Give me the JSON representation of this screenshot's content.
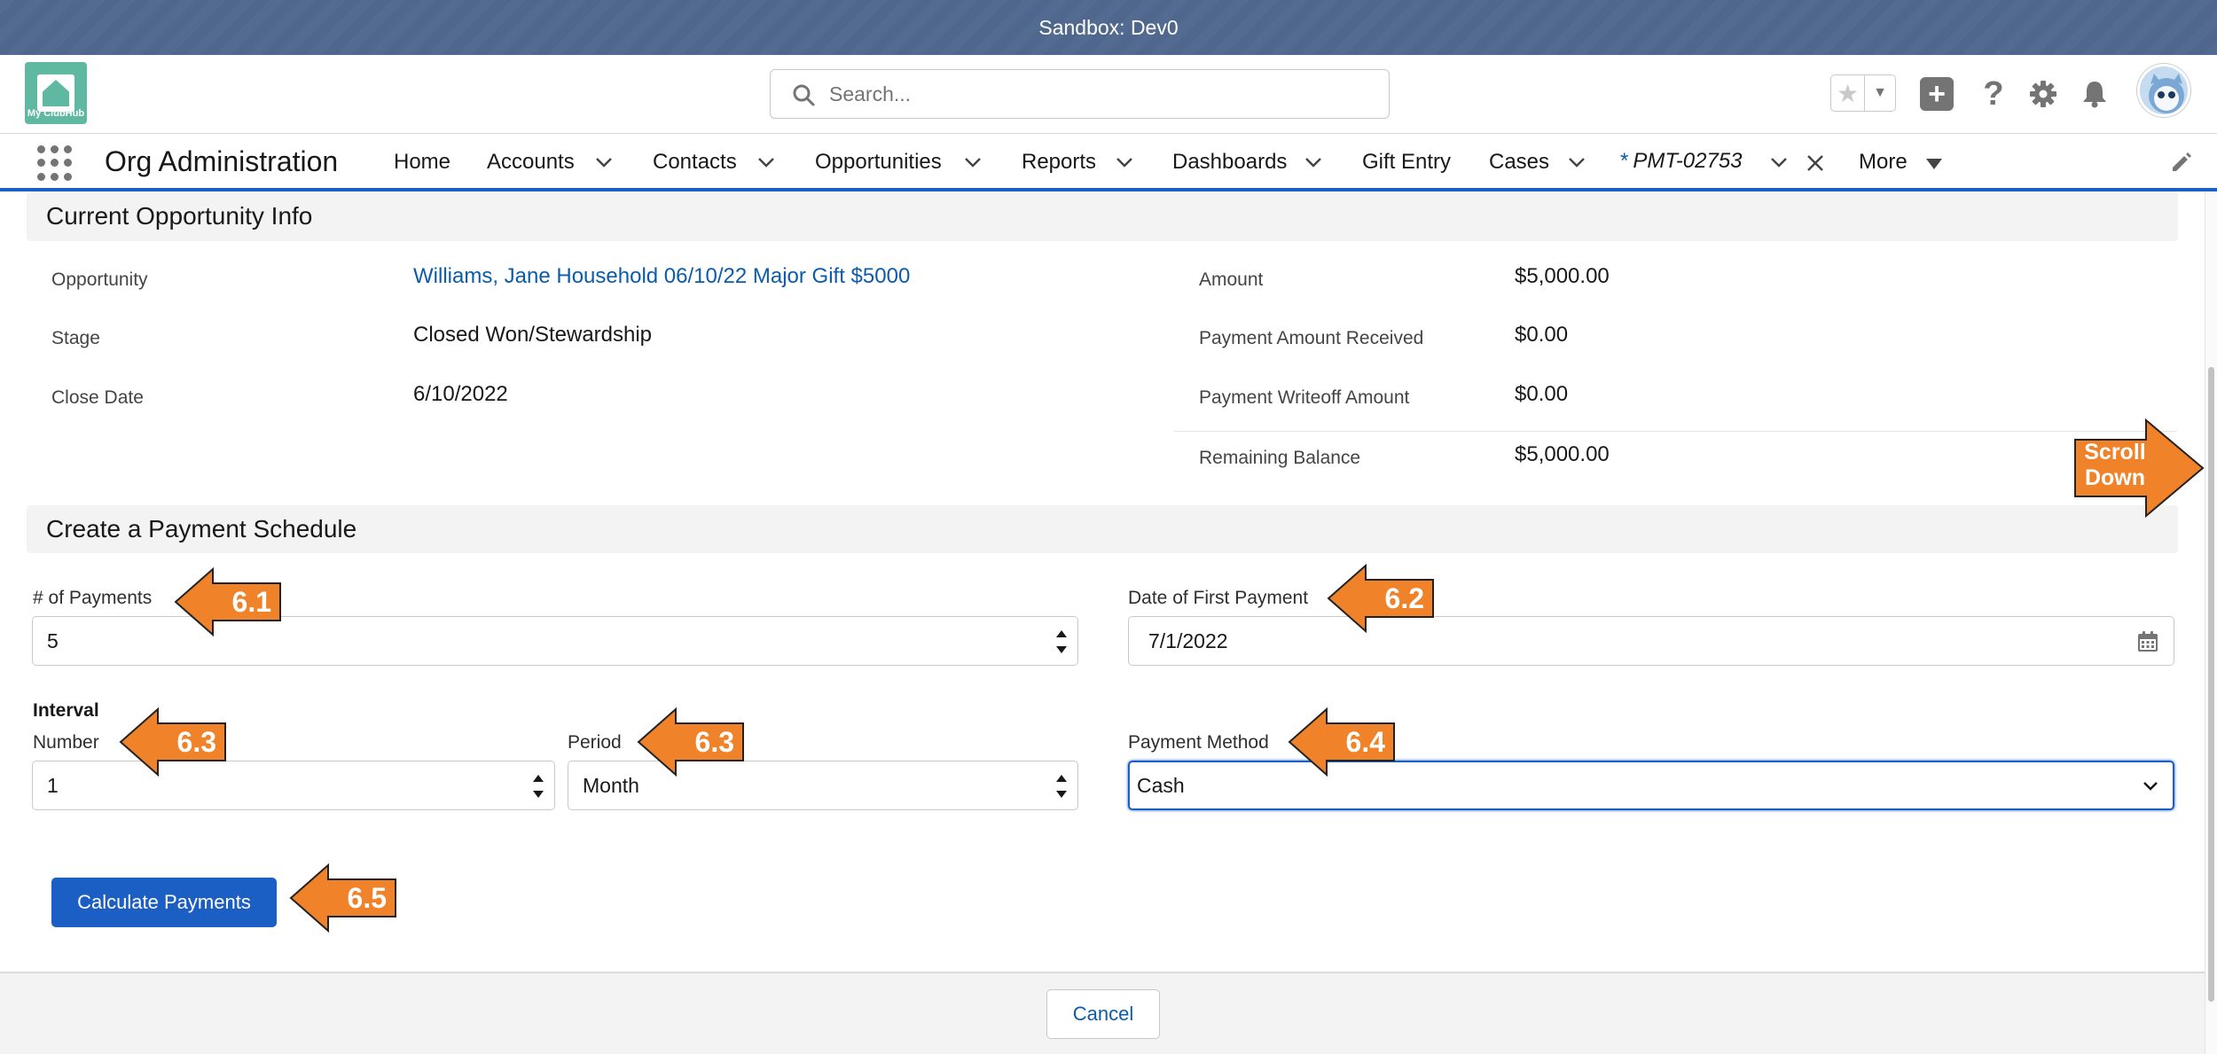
{
  "sandbox_banner": "Sandbox: Dev0",
  "header": {
    "logo_text": "My ClubHub",
    "search_placeholder": "Search..."
  },
  "nav": {
    "app_name": "Org Administration",
    "items": [
      "Home",
      "Accounts",
      "Contacts",
      "Opportunities",
      "Reports",
      "Dashboards",
      "Gift Entry",
      "Cases"
    ],
    "active_tab": {
      "prefix": "*",
      "label": "PMT-02753"
    },
    "more": "More"
  },
  "current_info": {
    "title": "Current Opportunity Info",
    "opportunity_label": "Opportunity",
    "opportunity_value": "Williams, Jane Household 06/10/22 Major Gift $5000",
    "stage_label": "Stage",
    "stage_value": "Closed Won/Stewardship",
    "close_date_label": "Close Date",
    "close_date_value": "6/10/2022",
    "amount_label": "Amount",
    "amount_value": "$5,000.00",
    "received_label": "Payment Amount Received",
    "received_value": "$0.00",
    "writeoff_label": "Payment Writeoff Amount",
    "writeoff_value": "$0.00",
    "remaining_label": "Remaining Balance",
    "remaining_value": "$5,000.00"
  },
  "schedule": {
    "title": "Create a Payment Schedule",
    "num_payments_label": "# of Payments",
    "num_payments_value": "5",
    "first_date_label": "Date of First Payment",
    "first_date_value": "7/1/2022",
    "interval_label": "Interval",
    "number_label": "Number",
    "number_value": "1",
    "period_label": "Period",
    "period_value": "Month",
    "method_label": "Payment Method",
    "method_value": "Cash",
    "calculate_button": "Calculate Payments"
  },
  "footer": {
    "cancel_button": "Cancel"
  },
  "annotations": {
    "a1": "6.1",
    "a2": "6.2",
    "a3a": "6.3",
    "a3b": "6.3",
    "a4": "6.4",
    "a5": "6.5",
    "scroll": "Scroll Down"
  },
  "colors": {
    "brand_blue": "#1b5ec4",
    "link_blue": "#0b5cab",
    "annotation_orange": "#f0832a",
    "banner": "#536b91"
  }
}
